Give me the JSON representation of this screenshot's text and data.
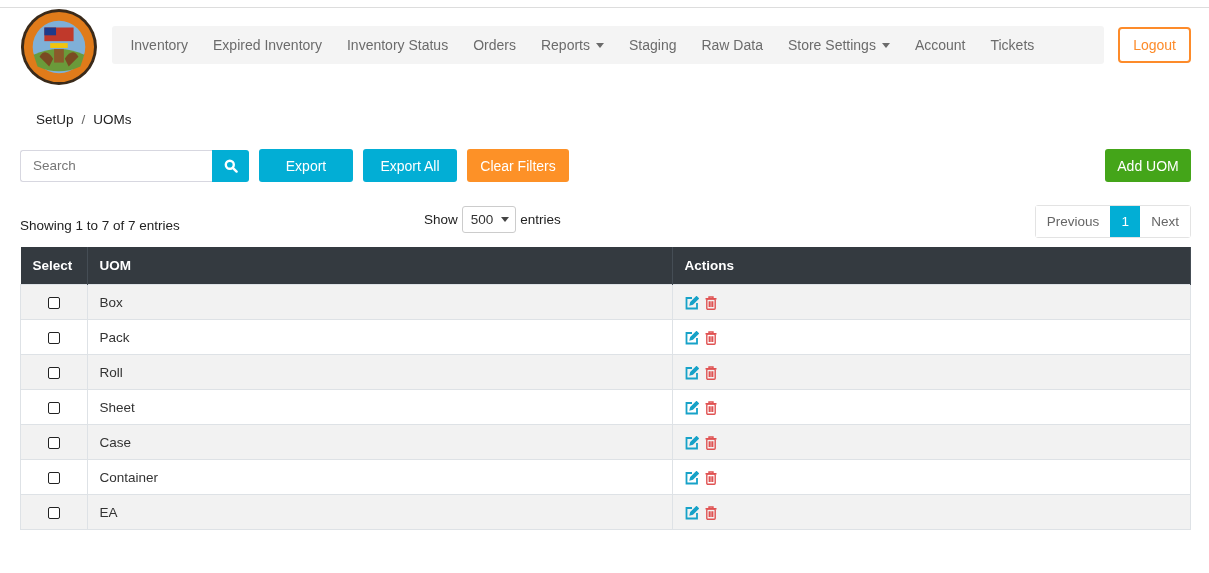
{
  "nav": {
    "items": [
      {
        "label": "Inventory",
        "dropdown": false
      },
      {
        "label": "Expired Inventory",
        "dropdown": false
      },
      {
        "label": "Inventory Status",
        "dropdown": false
      },
      {
        "label": "Orders",
        "dropdown": false
      },
      {
        "label": "Reports",
        "dropdown": true
      },
      {
        "label": "Staging",
        "dropdown": false
      },
      {
        "label": "Raw Data",
        "dropdown": false
      },
      {
        "label": "Store Settings",
        "dropdown": true
      },
      {
        "label": "Account",
        "dropdown": false
      },
      {
        "label": "Tickets",
        "dropdown": false
      }
    ],
    "logout": "Logout"
  },
  "breadcrumb": {
    "items": [
      "SetUp",
      "UOMs"
    ],
    "separator": "/"
  },
  "toolbar": {
    "search": {
      "placeholder": "Search"
    },
    "buttons": [
      {
        "label": "Export",
        "kind": "info"
      },
      {
        "label": "Export All",
        "kind": "info"
      },
      {
        "label": "Clear Filters",
        "kind": "warning"
      }
    ],
    "add_button": "Add UOM"
  },
  "info": "Showing 1 to 7 of 7 entries",
  "length": {
    "before": "Show",
    "value": "500",
    "after": "entries"
  },
  "pagination": {
    "previous": "Previous",
    "pages": [
      {
        "label": "1",
        "selected": true
      }
    ],
    "next": "Next"
  },
  "table": {
    "columns": [
      "Select",
      "UOM",
      "Actions"
    ],
    "rows": [
      {
        "uom": "Box",
        "checked": false
      },
      {
        "uom": "Pack",
        "checked": false
      },
      {
        "uom": "Roll",
        "checked": false
      },
      {
        "uom": "Sheet",
        "checked": false
      },
      {
        "uom": "Case",
        "checked": false
      },
      {
        "uom": "Container",
        "checked": false
      },
      {
        "uom": "EA",
        "checked": false
      }
    ]
  }
}
